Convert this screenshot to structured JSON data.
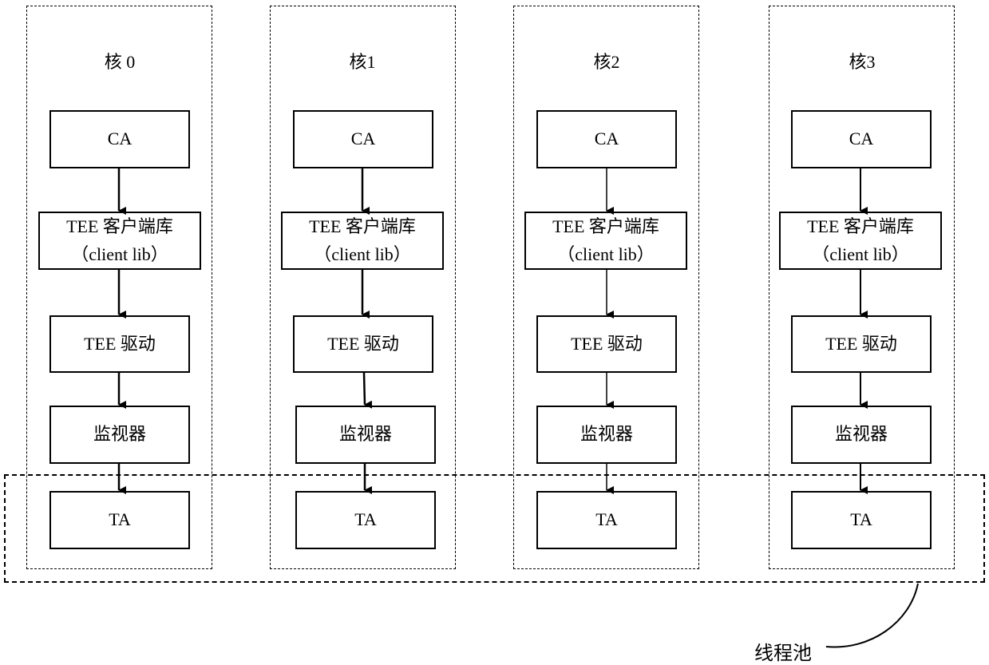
{
  "diagram": {
    "cores": [
      {
        "title": "核 0",
        "nodes": {
          "ca": "CA",
          "client_lib_line1": "TEE 客户端库",
          "client_lib_line2": "（client lib）",
          "driver": "TEE 驱动",
          "monitor": "监视器",
          "ta": "TA"
        }
      },
      {
        "title": "核1",
        "nodes": {
          "ca": "CA",
          "client_lib_line1": "TEE 客户端库",
          "client_lib_line2": "（client lib）",
          "driver": "TEE 驱动",
          "monitor": "监视器",
          "ta": "TA"
        }
      },
      {
        "title": "核2",
        "nodes": {
          "ca": "CA",
          "client_lib_line1": "TEE 客户端库",
          "client_lib_line2": "（client lib）",
          "driver": "TEE 驱动",
          "monitor": "监视器",
          "ta": "TA"
        }
      },
      {
        "title": "核3",
        "nodes": {
          "ca": "CA",
          "client_lib_line1": "TEE 客户端库",
          "client_lib_line2": "（client lib）",
          "driver": "TEE 驱动",
          "monitor": "监视器",
          "ta": "TA"
        }
      }
    ],
    "thread_pool_label": "线程池"
  }
}
